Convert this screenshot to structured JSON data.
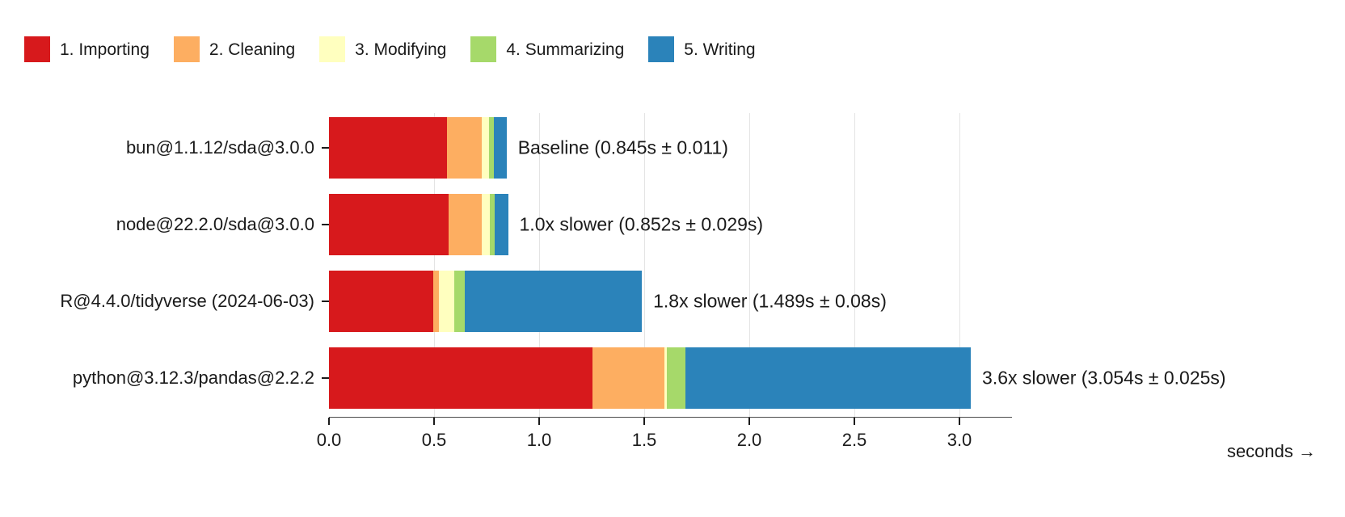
{
  "legend": {
    "items": [
      {
        "label": "1. Importing",
        "color": "#d7191c",
        "swatch_name": "legend-swatch-importing"
      },
      {
        "label": "2. Cleaning",
        "color": "#fdae61",
        "swatch_name": "legend-swatch-cleaning"
      },
      {
        "label": "3. Modifying",
        "color": "#ffffbf",
        "swatch_name": "legend-swatch-modifying"
      },
      {
        "label": "4. Summarizing",
        "color": "#a6d96a",
        "swatch_name": "legend-swatch-summarizing"
      },
      {
        "label": "5. Writing",
        "color": "#2b83ba",
        "swatch_name": "legend-swatch-writing"
      }
    ]
  },
  "chart_data": {
    "type": "bar",
    "orientation": "horizontal",
    "stacked": true,
    "title": "",
    "xlabel": "seconds →",
    "ylabel": "",
    "xlim": [
      0.0,
      3.25
    ],
    "xticks": [
      "0.0",
      "0.5",
      "1.0",
      "1.5",
      "2.0",
      "2.5",
      "3.0"
    ],
    "xtick_values": [
      0.0,
      0.5,
      1.0,
      1.5,
      2.0,
      2.5,
      3.0
    ],
    "grid": "vertical",
    "legend_position": "top-left",
    "categories": [
      "bun@1.1.12/sda@3.0.0",
      "node@22.2.0/sda@3.0.0",
      "R@4.4.0/tidyverse (2024-06-03)",
      "python@3.12.3/pandas@2.2.2"
    ],
    "series": [
      {
        "name": "1. Importing",
        "color": "#d7191c",
        "values": [
          0.563,
          0.568,
          0.498,
          1.253
        ]
      },
      {
        "name": "2. Cleaning",
        "color": "#fdae61",
        "values": [
          0.165,
          0.158,
          0.026,
          0.345
        ]
      },
      {
        "name": "3. Modifying",
        "color": "#ffffbf",
        "values": [
          0.033,
          0.038,
          0.073,
          0.01
        ]
      },
      {
        "name": "4. Summarizing",
        "color": "#a6d96a",
        "values": [
          0.022,
          0.024,
          0.049,
          0.088
        ]
      },
      {
        "name": "5. Writing",
        "color": "#2b83ba",
        "values": [
          0.062,
          0.064,
          0.843,
          1.358
        ]
      }
    ],
    "totals": [
      0.845,
      0.852,
      1.489,
      3.054
    ],
    "annotations": [
      "Baseline (0.845s ± 0.011)",
      "1.0x slower (0.852s ± 0.029s)",
      "1.8x slower (1.489s ± 0.08s)",
      "3.6x slower (3.054s ± 0.025s)"
    ]
  }
}
